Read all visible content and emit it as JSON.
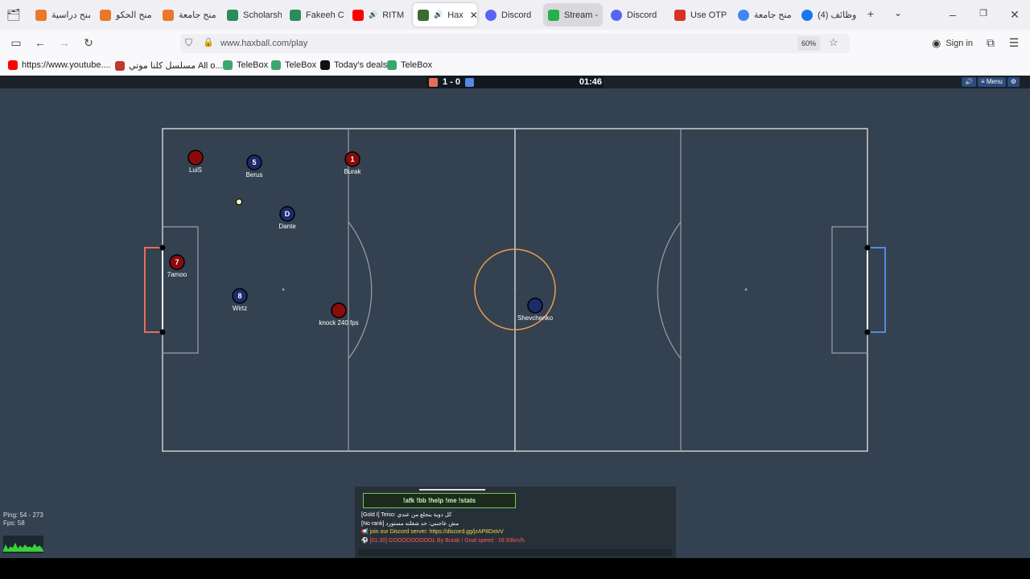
{
  "browser": {
    "tabs": [
      {
        "label": "منح دراسية",
        "icon": "orange-square-icon",
        "color": "#e8792b"
      },
      {
        "label": "منح الحكو",
        "icon": "orange-square-icon",
        "color": "#e8792b"
      },
      {
        "label": "منح جامعة",
        "icon": "orange-square-icon",
        "color": "#e8792b"
      },
      {
        "label": "Scholarsh",
        "icon": "leaf-icon",
        "color": "#2a8c5a"
      },
      {
        "label": "Fakeeh C",
        "icon": "leaf-icon",
        "color": "#2a8c5a"
      },
      {
        "label": "RITM",
        "icon": "youtube-icon",
        "color": "#ff0000"
      },
      {
        "label": "Hax",
        "icon": "haxball-icon",
        "color": "#3c6b2f"
      },
      {
        "label": "Discord",
        "icon": "discord-icon",
        "color": "#5865f2"
      },
      {
        "label": "Stream -",
        "icon": "kick-icon",
        "color": "#26b04a"
      },
      {
        "label": "Discord",
        "icon": "discord-icon",
        "color": "#5865f2"
      },
      {
        "label": "Use OTP",
        "icon": "gmail-icon",
        "color": "#d93025"
      },
      {
        "label": "منح جامعة",
        "icon": "google-icon",
        "color": "#4285f4"
      },
      {
        "label": "(4) وظائف",
        "icon": "facebook-icon",
        "color": "#1877f2"
      }
    ],
    "new_tab": "+",
    "url": "www.haxball.com/play",
    "zoom": "60%",
    "signin": "Sign in",
    "bookmarks": [
      {
        "label": "https://www.youtube....",
        "icon": "youtube-icon",
        "color": "#ff0000"
      },
      {
        "label": "مسلسل كلنا موتي All o...",
        "icon": "tv-icon",
        "color": "#c0392b"
      },
      {
        "label": "TeleBox",
        "icon": "telebox-icon",
        "color": "#3aa76d"
      },
      {
        "label": "TeleBox",
        "icon": "telebox-icon",
        "color": "#3aa76d"
      },
      {
        "label": "Today's deals",
        "icon": "amazon-icon",
        "color": "#111111"
      },
      {
        "label": "TeleBox",
        "icon": "telebox-icon",
        "color": "#3aa76d"
      }
    ]
  },
  "game": {
    "score": "1 - 0",
    "time": "01:46",
    "menu_label": "Menu",
    "colors": {
      "red": "#e56e56",
      "blue": "#5689e5",
      "red_player": "#8b0a0a",
      "blue_player": "#1c2b6b",
      "ball": "#fffbb0",
      "kickoff": "#e7a04a"
    },
    "players": [
      {
        "name": "LuiS",
        "num": "",
        "team": "red"
      },
      {
        "name": "Berus",
        "num": "5",
        "team": "blue"
      },
      {
        "name": "Burak",
        "num": "1",
        "team": "red"
      },
      {
        "name": "Dante",
        "num": "D",
        "team": "blue"
      },
      {
        "name": "7amoo",
        "num": "7",
        "team": "red"
      },
      {
        "name": "Wirtz",
        "num": "8",
        "team": "blue"
      },
      {
        "name": "knock 240 fps",
        "num": "",
        "team": "red"
      },
      {
        "name": "Shevchenko",
        "num": "",
        "team": "blue"
      }
    ],
    "stats": {
      "ping": "Ping: 54 - 273",
      "fps": "Fps: 58"
    },
    "chat": {
      "commands": "!afk !bb !help !me !stats",
      "lines": [
        {
          "text": "[Gold I] Teiso: كل دوية ينجلع من عندي",
          "color": "#ffffff"
        },
        {
          "text": "[No rank] مش عاجبني: حد شغلته مستورد",
          "color": "#ffffff"
        },
        {
          "text": "📢 join our Discord server: https://discord.gg/jzAP8DxtvV",
          "color": "#f5d547"
        },
        {
          "text": "⚽ [01:30] GOOOOOOOOOL By Burak ! Goal speed : 18.93km/h.",
          "color": "#ff5a5a"
        }
      ]
    }
  }
}
